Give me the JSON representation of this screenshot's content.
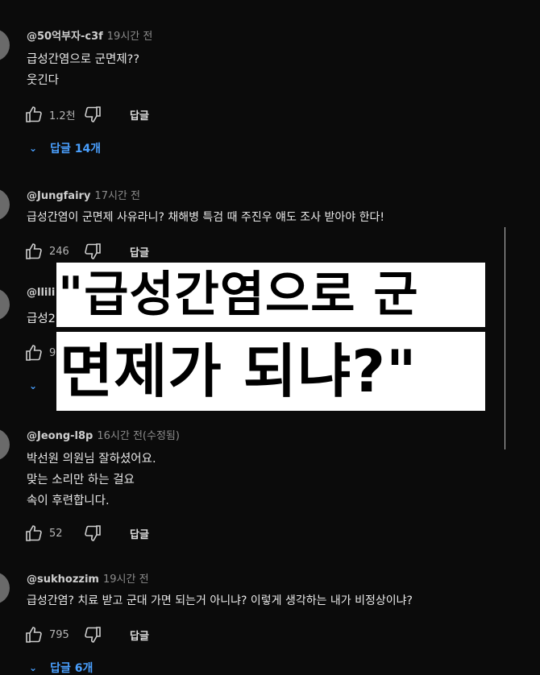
{
  "comments": [
    {
      "author": "@50억부자-c3f",
      "time": "19시간 전",
      "lines": [
        "급성간염으로 군면제??",
        "웃긴다"
      ],
      "likes": "1.2천",
      "reply_label": "답글",
      "replies_label": "답글 14개"
    },
    {
      "author": "@Jungfairy",
      "time": "17시간 전",
      "lines": [
        "급성간염이 군면제 사유라니? 채해병 특검 때 주진우 얘도 조사 받아야 한다!"
      ],
      "likes": "246",
      "reply_label": "답글"
    },
    {
      "author": "@llili",
      "lines": [
        "급성2"
      ],
      "likes": "9"
    },
    {
      "author": "@Jeong-l8p",
      "time": "16시간 전(수정됨)",
      "lines": [
        "박선원 의원님 잘하셨어요.",
        "맞는 소리만 하는 걸요",
        "속이 후련합니다."
      ],
      "likes": "52",
      "reply_label": "답글"
    },
    {
      "author": "@sukhozzim",
      "time": "19시간 전",
      "lines": [
        "급성간염? 치료 받고 군대 가면 되는거 아니냐? 이렇게 생각하는 내가 비정상이냐?"
      ],
      "likes": "795",
      "reply_label": "답글",
      "replies_label": "답글 6개"
    }
  ],
  "overlay": {
    "line1": "\"급성간염으로 군",
    "line2": "면제가 되냐?\""
  },
  "colors": {
    "background": "#0b0b0b",
    "link_blue": "#4aa0ff",
    "headline_bg": "#ffffff"
  },
  "icons": [
    "thumbs-up-icon",
    "thumbs-down-icon",
    "chevron-down-icon"
  ]
}
